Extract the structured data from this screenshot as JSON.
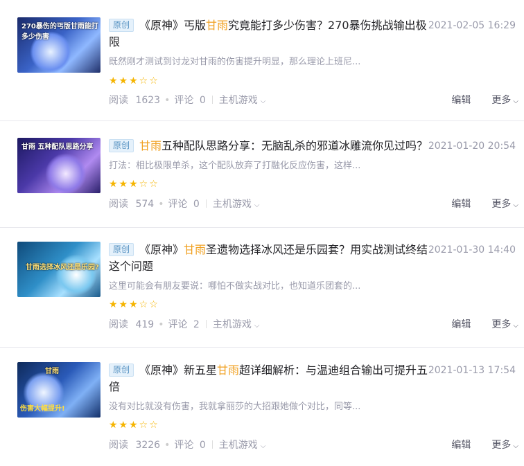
{
  "articles": [
    {
      "badge": "原创",
      "title_pre": "《原神》丐版",
      "title_hl": "甘雨",
      "title_post": "究竟能打多少伤害？270暴伤挑战输出极限",
      "date": "2021-02-05 16:29",
      "desc": "既然刚才测试到讨龙对甘雨的伤害提升明显，那么理论上班尼...",
      "stars": "★★★☆☆",
      "read_label": "阅读",
      "read_count": "1623",
      "comment_label": "评论",
      "comment_count": "0",
      "category": "主机游戏",
      "edit": "编辑",
      "more": "更多",
      "thumb_text": "270暴伤的丐版甘雨能打多少伤害",
      "thumb_sub": ""
    },
    {
      "badge": "原创",
      "title_pre": "",
      "title_hl": "甘雨",
      "title_post": "五种配队思路分享：无脑乱杀的邪道冰雕流你见过吗？",
      "date": "2021-01-20 20:54",
      "desc": "打法：相比极限单杀，这个配队放弃了打融化反应伤害，这样...",
      "stars": "★★★☆☆",
      "read_label": "阅读",
      "read_count": "574",
      "comment_label": "评论",
      "comment_count": "0",
      "category": "主机游戏",
      "edit": "编辑",
      "more": "更多",
      "thumb_text": "甘雨 五种配队思路分享",
      "thumb_sub": ""
    },
    {
      "badge": "原创",
      "title_pre": "《原神》",
      "title_hl": "甘雨",
      "title_post": "圣遗物选择冰风还是乐园套？用实战测试终结这个问题",
      "date": "2021-01-30 14:40",
      "desc": "这里可能会有朋友要说：哪怕不做实战对比，也知道乐团套的...",
      "stars": "★★★☆☆",
      "read_label": "阅读",
      "read_count": "419",
      "comment_label": "评论",
      "comment_count": "2",
      "category": "主机游戏",
      "edit": "编辑",
      "more": "更多",
      "thumb_text": "甘雨选择冰风还是乐园?",
      "thumb_sub": ""
    },
    {
      "badge": "原创",
      "title_pre": "《原神》新五星",
      "title_hl": "甘雨",
      "title_post": "超详细解析：与温迪组合输出可提升五倍",
      "date": "2021-01-13 17:54",
      "desc": "没有对比就没有伤害，我就拿丽莎的大招跟她做个对比，同等...",
      "stars": "★★★☆☆",
      "read_label": "阅读",
      "read_count": "3226",
      "comment_label": "评论",
      "comment_count": "0",
      "category": "主机游戏",
      "edit": "编辑",
      "more": "更多",
      "thumb_text": "甘雨",
      "thumb_sub": "伤害大幅提升!"
    }
  ],
  "icons": {
    "caret": "chevron-down-icon",
    "dot": "•"
  },
  "colors": {
    "highlight": "#f0a020",
    "badge_text": "#5893c2",
    "badge_bg": "#e5f1fb",
    "star": "#f5b400",
    "meta": "#999aaa"
  }
}
